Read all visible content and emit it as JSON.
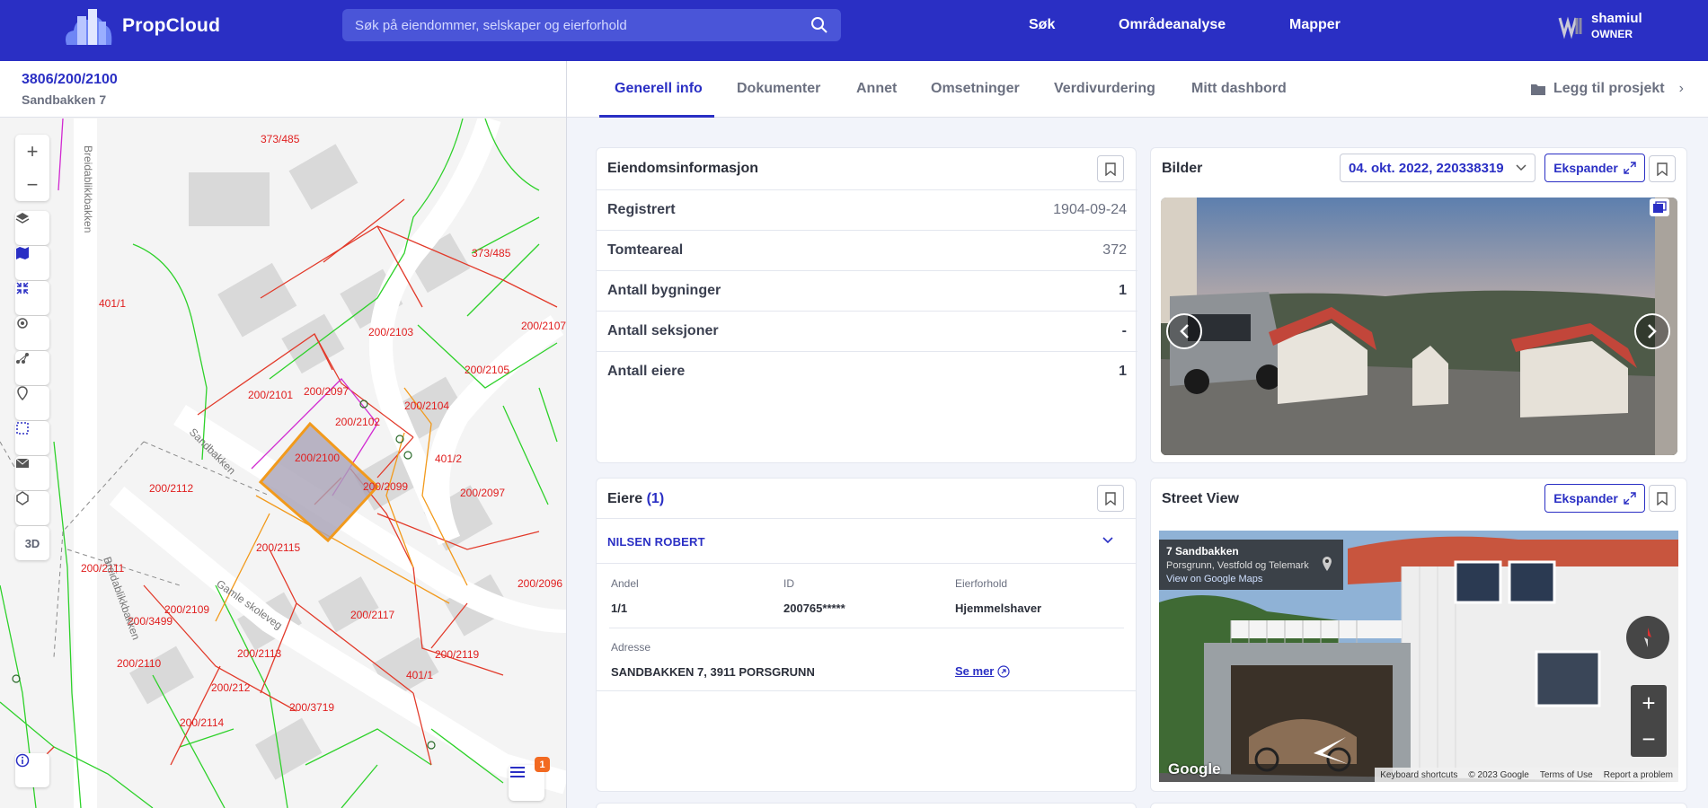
{
  "app": {
    "name": "PropCloud"
  },
  "search": {
    "placeholder": "Søk på eiendommer, selskaper og eierforhold"
  },
  "nav": {
    "items": [
      "Søk",
      "Områdeanalyse",
      "Mapper"
    ]
  },
  "user": {
    "name": "shamiul",
    "role": "OWNER"
  },
  "property": {
    "id": "3806/200/2100",
    "address": "Sandbakken 7"
  },
  "tabs": [
    "Generell info",
    "Dokumenter",
    "Annet",
    "Omsetninger",
    "Verdivurdering",
    "Mitt dashbord"
  ],
  "add_to_project": "Legg til prosjekt",
  "map": {
    "tools": {
      "three_d": "3D"
    },
    "legend_badge": "1",
    "parcel_labels": [
      "373/485",
      "373/485",
      "401/1",
      "200/2103",
      "200/2107",
      "200/2105",
      "200/2101",
      "200/2097",
      "200/2104",
      "200/2102",
      "200/2100",
      "401/2",
      "200/2099",
      "200/2097",
      "200/2112",
      "200/2115",
      "200/2111",
      "200/2117",
      "200/2109",
      "200/3499",
      "200/2113",
      "200/2119",
      "200/2110",
      "200/212",
      "401/1",
      "200/3719",
      "200/2114",
      "200/2096"
    ],
    "street_labels": [
      "Breidablikkbakken",
      "Sandbakken",
      "Gamle skoleveg",
      "Breidablikkbakken"
    ]
  },
  "property_info": {
    "title": "Eiendomsinformasjon",
    "rows": [
      {
        "label": "Registrert",
        "value": "1904-09-24"
      },
      {
        "label": "Tomteareal",
        "value": "372"
      },
      {
        "label": "Antall bygninger",
        "value": "1"
      },
      {
        "label": "Antall seksjoner",
        "value": "-"
      },
      {
        "label": "Antall eiere",
        "value": "1"
      }
    ]
  },
  "images": {
    "title": "Bilder",
    "selected_date": "04. okt. 2022, 220338319",
    "expand_label": "Ekspander"
  },
  "owners": {
    "title": "Eiere",
    "count": "(1)",
    "owner_name": "NILSEN ROBERT",
    "columns": {
      "share": "Andel",
      "id": "ID",
      "relation": "Eierforhold",
      "address": "Adresse"
    },
    "values": {
      "share": "1/1",
      "id": "200765*****",
      "relation": "Hjemmelshaver",
      "address": "SANDBAKKEN 7, 3911 PORSGRUNN"
    },
    "see_more": "Se mer"
  },
  "street_view": {
    "title": "Street View",
    "expand_label": "Ekspander",
    "place_title": "7 Sandbakken",
    "place_sub": "Porsgrunn, Vestfold og Telemark",
    "place_link": "View on Google Maps",
    "logo": "Google",
    "footer": [
      "Keyboard shortcuts",
      "© 2023 Google",
      "Terms of Use",
      "Report a problem"
    ]
  },
  "colors": {
    "brand": "#2a2fc4",
    "parcel_red": "#e23a2a",
    "parcel_green": "#2ed12a",
    "selected": "#f29a1c",
    "pink": "#d12ad1"
  }
}
